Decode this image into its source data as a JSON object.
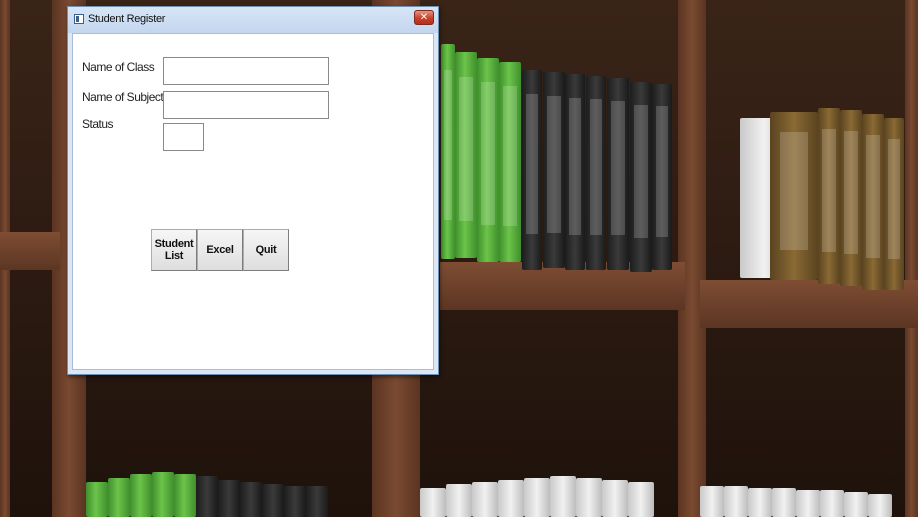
{
  "window": {
    "title": "Student Register",
    "close_glyph": "✕"
  },
  "form": {
    "class_label": "Name of Class",
    "class_value": "",
    "subject_label": "Name of Subject",
    "subject_value": "",
    "status_label": "Status",
    "status_value": ""
  },
  "buttons": {
    "student_list": "Student\nList",
    "excel": "Excel",
    "quit": "Quit"
  },
  "icons": {
    "app": "window-app-icon",
    "close": "close-icon"
  }
}
